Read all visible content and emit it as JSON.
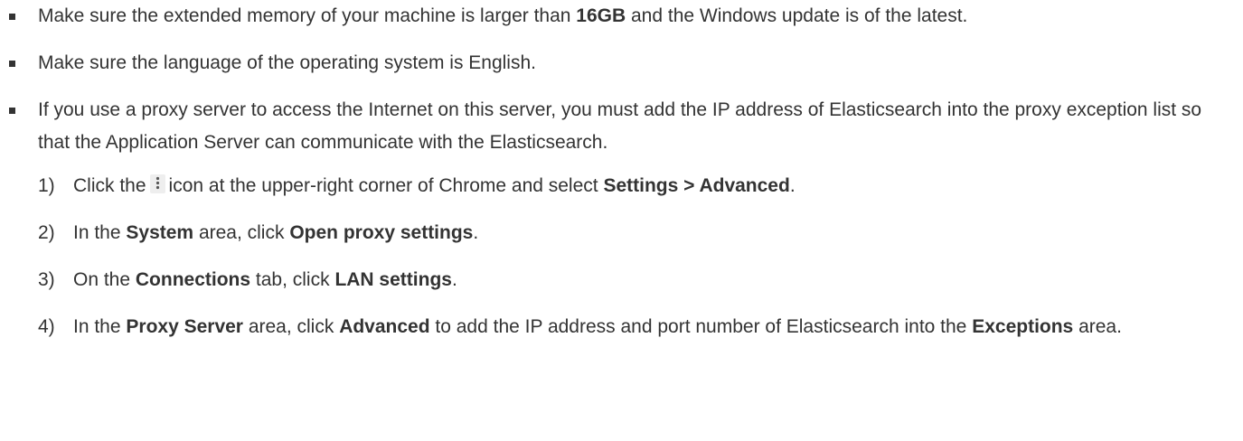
{
  "bullets": [
    {
      "t1": "Make sure the extended memory of your machine is larger than ",
      "b1": "16GB",
      "t2": " and the Windows update is of the latest."
    },
    {
      "t1": "Make sure the language of the operating system is English."
    },
    {
      "t1": "If you use a proxy server to access the Internet on this server, you must add the IP address of Elasticsearch into the proxy exception list so that the Application Server can communicate with the Elasticsearch."
    }
  ],
  "steps": [
    {
      "num": "1)",
      "t1": "Click the",
      "icon": "more-vertical-icon",
      "t2": "icon at the upper-right corner of Chrome and select ",
      "b1": "Settings > Advanced",
      "t3": "."
    },
    {
      "num": "2)",
      "t1": "In the ",
      "b1": "System",
      "t2": " area, click ",
      "b2": "Open proxy settings",
      "t3": "."
    },
    {
      "num": "3)",
      "t1": "On the ",
      "b1": "Connections",
      "t2": " tab, click ",
      "b2": "LAN settings",
      "t3": "."
    },
    {
      "num": "4)",
      "t1": "In the ",
      "b1": "Proxy Server",
      "t2": " area, click ",
      "b2": "Advanced",
      "t3": " to add the IP address and port number of Elasticsearch into the ",
      "b3": "Exceptions",
      "t4": " area."
    }
  ]
}
